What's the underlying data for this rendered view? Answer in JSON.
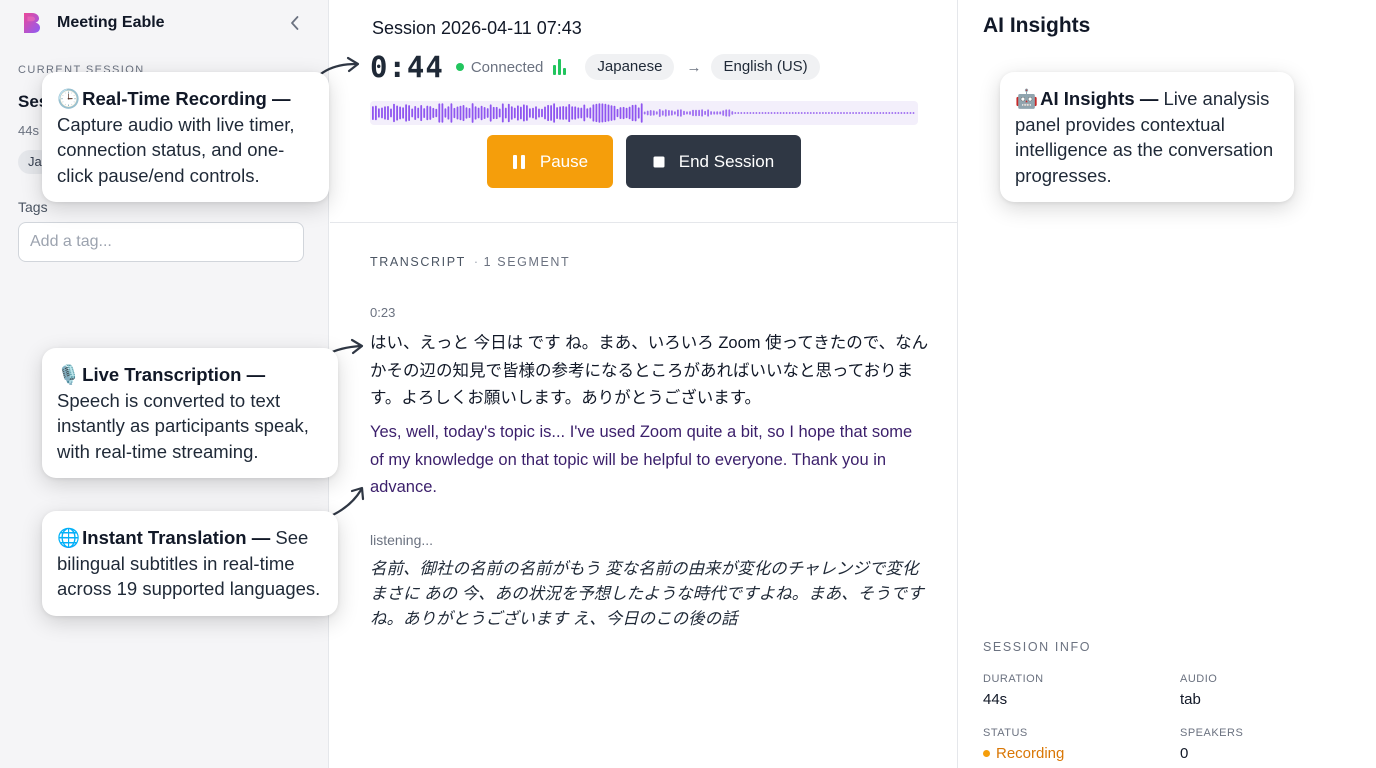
{
  "app": {
    "name": "Meeting Eable"
  },
  "sidebar": {
    "collapse_icon": "chevron-left-icon",
    "current_session_label": "CURRENT SESSION",
    "session_name": "Ses",
    "session_duration": "44s",
    "session_chip": "Ja",
    "tags_label": "Tags",
    "tag_placeholder": "Add a tag..."
  },
  "main": {
    "session_title": "Session 2026-04-11 07:43",
    "timer": "0:44",
    "connection_status": "Connected",
    "source_language": "Japanese",
    "target_language": "English (US)",
    "pause_label": "Pause",
    "end_session_label": "End Session",
    "transcript_label": "TRANSCRIPT",
    "segment_count": "1 SEGMENT",
    "segments": [
      {
        "time": "0:23",
        "original": "はい、えっと 今日は です ね。まあ、いろいろ Zoom 使ってきたので、なんかその辺の知見で皆様の参考になるところがあればいいなと思っております。よろしくお願いします。ありがとうございます。",
        "translation": "Yes, well, today's topic is... I've used Zoom quite a bit, so I hope that some of my knowledge on that topic will be helpful to everyone. Thank you in advance."
      }
    ],
    "listening_label": "listening...",
    "interim_text": "名前、御社の名前の名前がもう 変な名前の由来が変化のチャレンジで変化 まさに あの 今、あの状況を予想したような時代ですよね。まあ、そうですね。ありがとうございます え、今日のこの後の話"
  },
  "insights": {
    "title": "AI Insights",
    "session_info_label": "SESSION INFO",
    "fields": {
      "duration_label": "DURATION",
      "duration": "44s",
      "audio_label": "AUDIO",
      "audio": "tab",
      "status_label": "STATUS",
      "status": "Recording",
      "speakers_label": "SPEAKERS",
      "speakers": "0"
    }
  },
  "callouts": {
    "recording": {
      "icon": "🕒",
      "title": "Real-Time Recording",
      "body": "Capture audio with live timer, connection status, and one-click pause/end controls."
    },
    "transcription": {
      "icon": "🎙️",
      "title": "Live Transcription",
      "body": "Speech is converted to text instantly as participants speak, with real-time streaming."
    },
    "translation": {
      "icon": "🌐",
      "title": "Instant Translation",
      "body": "See bilingual subtitles in real-time across 19 supported languages."
    },
    "insights": {
      "icon": "🤖",
      "title": "AI Insights",
      "body": "Live analysis panel provides contextual intelligence as the conversation progresses."
    }
  },
  "colors": {
    "accent_purple": "#7c3aed",
    "pause_orange": "#f59e0b",
    "end_dark": "#2f3744",
    "connected_green": "#22c55e",
    "translation_text": "#3b1f6b",
    "recording_status": "#d97706"
  }
}
